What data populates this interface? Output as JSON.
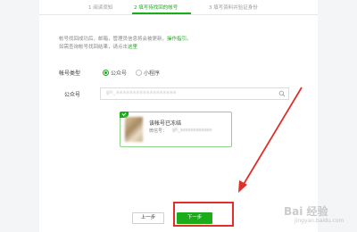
{
  "stepper": {
    "steps": [
      {
        "label": "1 阅读须知"
      },
      {
        "label": "2 填写待找回的帐号"
      },
      {
        "label": "3 填写资料并验证身份"
      }
    ],
    "active_index": 1
  },
  "notice": {
    "line1_text": "帐号找回成功后，邮箱，管理员信息将会被更新，",
    "line1_link": "操作指引",
    "line1_end": "。",
    "line2_text": "如需查询帐号找回结果，请点击",
    "line2_link": "这里"
  },
  "account_type": {
    "label": "帐号类型",
    "options": [
      {
        "label": "公众号",
        "checked": true
      },
      {
        "label": "小程序",
        "checked": false
      }
    ]
  },
  "search": {
    "label": "公众号",
    "value": "gh_xxxxxxxxxxxxxxxxxx"
  },
  "result_card": {
    "name": "该帐号已冻结",
    "id_label": "微信号：",
    "id_value": "gh_xxxxxxxxxxxx"
  },
  "buttons": {
    "prev_label": "上一步",
    "next_label": "下一步"
  },
  "watermark": {
    "text": "Bai 经验",
    "sub": "jingyan.baidu.com"
  },
  "colors": {
    "accent": "#1aad19",
    "annotation": "#e0302b"
  }
}
